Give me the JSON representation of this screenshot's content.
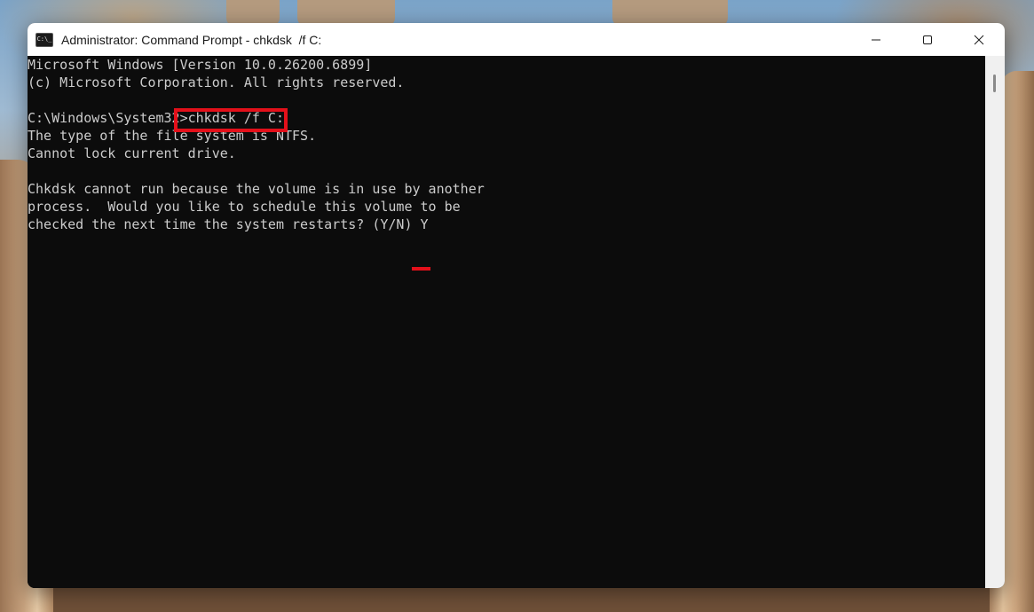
{
  "window": {
    "title": "Administrator: Command Prompt - chkdsk  /f C:",
    "icon_text": "C:\\_"
  },
  "console": {
    "lines": [
      "Microsoft Windows [Version 10.0.26200.6899]",
      "(c) Microsoft Corporation. All rights reserved.",
      "",
      "C:\\Windows\\System32>chkdsk /f C:",
      "The type of the file system is NTFS.",
      "Cannot lock current drive.",
      "",
      "Chkdsk cannot run because the volume is in use by another",
      "process.  Would you like to schedule this volume to be",
      "checked the next time the system restarts? (Y/N) Y"
    ]
  },
  "icons": {
    "minimize": "minimize-icon",
    "maximize": "maximize-icon",
    "close": "close-icon",
    "app": "command-prompt-icon"
  },
  "colors": {
    "console_bg": "#0c0c0c",
    "console_text": "#cccccc",
    "annotation": "#e3101a"
  }
}
